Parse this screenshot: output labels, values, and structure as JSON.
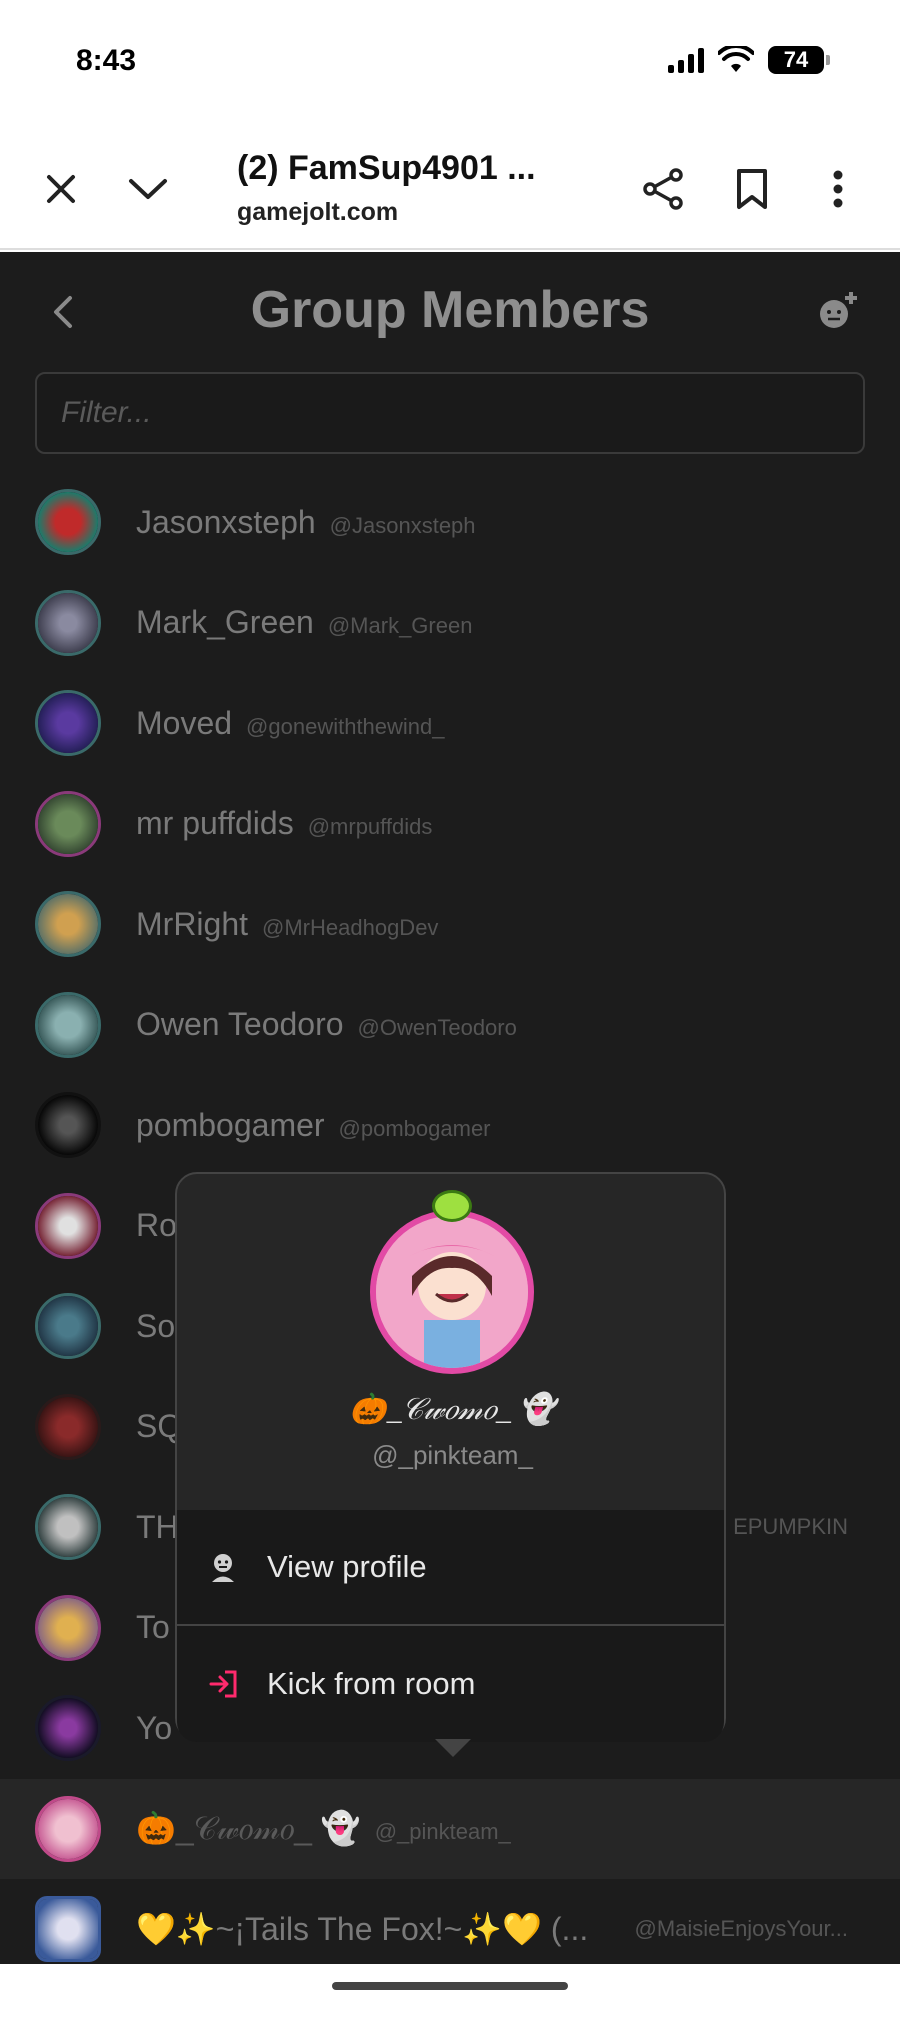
{
  "status": {
    "time": "8:43",
    "battery": "74"
  },
  "browser": {
    "title": "(2) FamSup4901 ...",
    "domain": "gamejolt.com"
  },
  "page": {
    "title": "Group Members",
    "filter_placeholder": "Filter..."
  },
  "members": [
    {
      "name": "Jasonxsteph",
      "handle": "@Jasonxsteph",
      "color": "#1e7a6a"
    },
    {
      "name": "Mark_Green",
      "handle": "@Mark_Green",
      "color": "#4a4a5a"
    },
    {
      "name": "Moved",
      "handle": "@gonewiththewind_",
      "color": "#2a2a6a"
    },
    {
      "name": "mr puffdids",
      "handle": "@mrpuffdids",
      "color": "#4a6a3a"
    },
    {
      "name": "MrRight",
      "handle": "@MrHeadhogDev",
      "color": "#7a6a3a"
    },
    {
      "name": "Owen Teodoro",
      "handle": "@OwenTeodoro",
      "color": "#3a6a6a"
    },
    {
      "name": "pombogamer",
      "handle": "@pombogamer",
      "color": "#111111"
    },
    {
      "name": "Ro",
      "handle": "",
      "color": "#7a2a3a"
    },
    {
      "name": "So",
      "handle": "",
      "color": "#2a4a5a"
    },
    {
      "name": "SQ",
      "handle": "",
      "color": "#3a1a1a"
    },
    {
      "name": "TH",
      "handle": "",
      "color": "#3a4a4a",
      "trailing": "EPUMPKIN"
    },
    {
      "name": "To",
      "handle": "",
      "color": "#7a5a8a"
    },
    {
      "name": "Yo",
      "handle": "",
      "color": "#2a1a3a"
    },
    {
      "name": "🎃_𝒞𝓌𝑜𝓂𝑜_ 👻",
      "handle": "@_pinkteam_",
      "color": "#c04a8a",
      "selected": true
    },
    {
      "name": "💛✨~¡Tails The Fox!~✨💛 (...",
      "handle": "@MaisieEnjoysYour...",
      "color": "#3a5a9a"
    }
  ],
  "popup": {
    "name": "🎃_𝒞𝓌𝑜𝓂𝑜_ 👻",
    "handle": "@_pinkteam_",
    "view_profile": "View profile",
    "kick": "Kick from room"
  },
  "colors": {
    "kick_icon": "#ff2a6d",
    "background": "#1c1c1c"
  }
}
